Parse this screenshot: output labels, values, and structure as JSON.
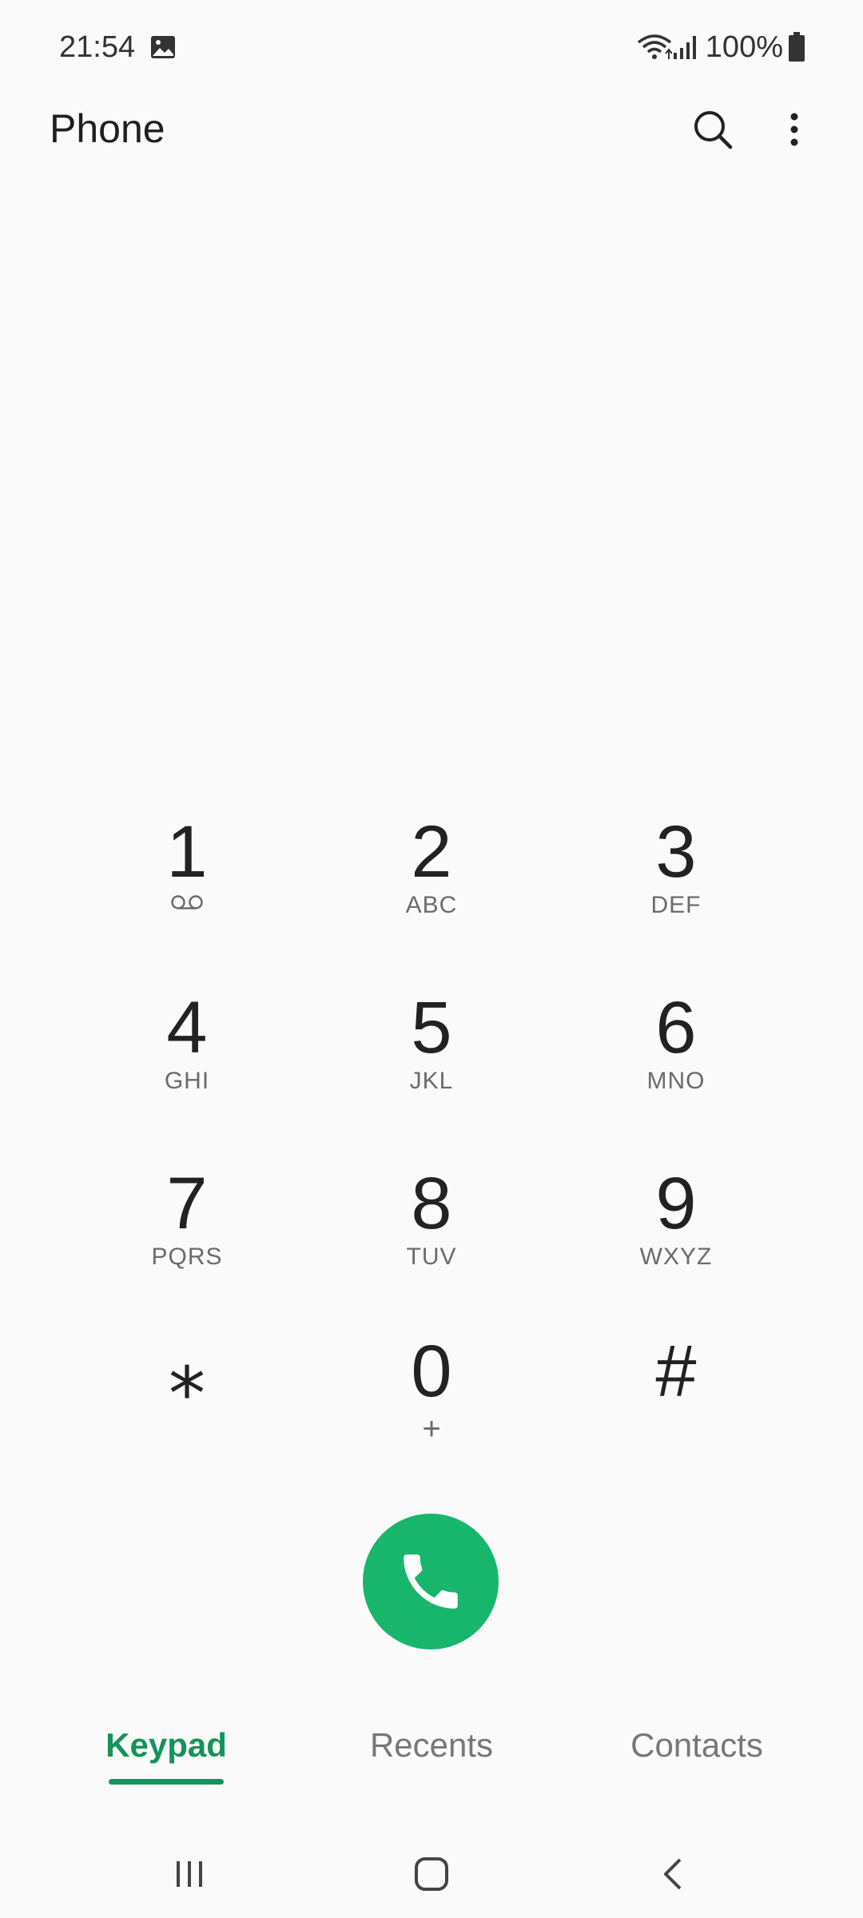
{
  "status_bar": {
    "time": "21:54",
    "battery": "100%",
    "icons": [
      "gallery-icon",
      "wifi-icon",
      "signal-icon",
      "battery-icon"
    ]
  },
  "app_bar": {
    "title": "Phone",
    "icons": [
      "search-icon",
      "more-options-icon"
    ]
  },
  "keypad": {
    "keys": [
      {
        "digit": "1",
        "letters": ""
      },
      {
        "digit": "2",
        "letters": "ABC"
      },
      {
        "digit": "3",
        "letters": "DEF"
      },
      {
        "digit": "4",
        "letters": "GHI"
      },
      {
        "digit": "5",
        "letters": "JKL"
      },
      {
        "digit": "6",
        "letters": "MNO"
      },
      {
        "digit": "7",
        "letters": "PQRS"
      },
      {
        "digit": "8",
        "letters": "TUV"
      },
      {
        "digit": "9",
        "letters": "WXYZ"
      },
      {
        "digit": "⁎",
        "letters": ""
      },
      {
        "digit": "0",
        "letters": "+"
      },
      {
        "digit": "#",
        "letters": ""
      }
    ]
  },
  "call_button": {
    "icon": "phone-icon"
  },
  "tabs": [
    {
      "label": "Keypad",
      "active": true
    },
    {
      "label": "Recents",
      "active": false
    },
    {
      "label": "Contacts",
      "active": false
    }
  ],
  "colors": {
    "accent": "#15935a",
    "call_button": "#17b66c",
    "background": "#fafafa"
  },
  "nav_bar": {
    "icons": [
      "recent-apps-icon",
      "home-icon",
      "back-icon"
    ]
  }
}
